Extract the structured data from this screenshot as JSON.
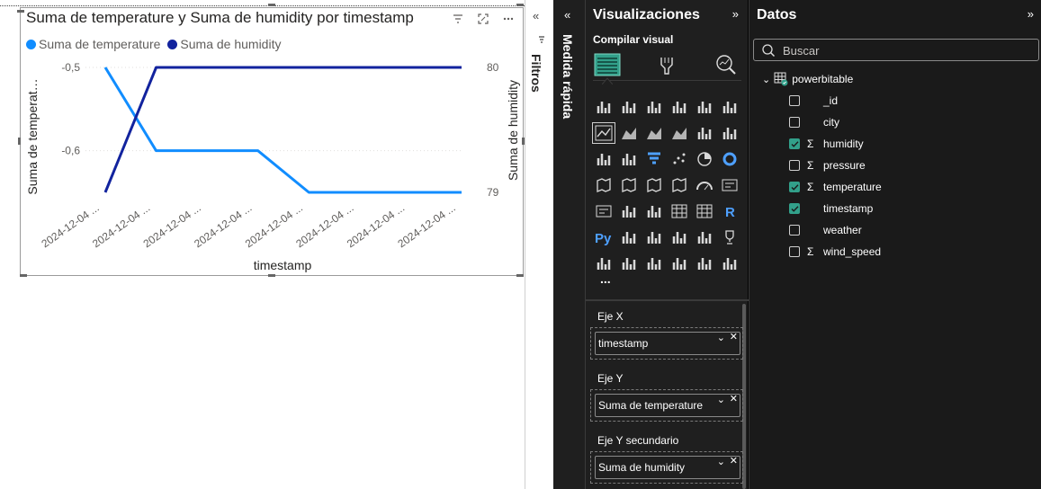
{
  "visual": {
    "title": "Suma de temperature y Suma de humidity por timestamp",
    "legend": [
      {
        "label": "Suma de temperature",
        "color": "#118dff"
      },
      {
        "label": "Suma de humidity",
        "color": "#12239e"
      }
    ],
    "header_icons": [
      "filter-icon",
      "focus-mode-icon",
      "more-options-icon"
    ]
  },
  "chart_data": {
    "type": "line",
    "title": "Suma de temperature y Suma de humidity por timestamp",
    "xlabel": "timestamp",
    "ylabel": "Suma de temperat…",
    "y2label": "Suma de humidity",
    "categories": [
      "2024-12-04 ...",
      "2024-12-04 ...",
      "2024-12-04 ...",
      "2024-12-04 ...",
      "2024-12-04 ...",
      "2024-12-04 ...",
      "2024-12-04 ...",
      "2024-12-04 ..."
    ],
    "y_ticks": [
      "-0,5",
      "-0,6"
    ],
    "y_tick_values": [
      -0.5,
      -0.6
    ],
    "y2_ticks": [
      "80",
      "79"
    ],
    "y2_tick_values": [
      80,
      79
    ],
    "ylim": [
      -0.65,
      -0.5
    ],
    "y2lim": [
      79,
      80
    ],
    "legend_position": "top-left",
    "grid": true,
    "series": [
      {
        "name": "Suma de temperature",
        "axis": "primary",
        "color": "#118dff",
        "values": [
          -0.5,
          -0.6,
          -0.6,
          -0.6,
          -0.65,
          -0.65,
          -0.65,
          -0.65
        ]
      },
      {
        "name": "Suma de humidity",
        "axis": "secondary",
        "color": "#12239e",
        "values": [
          79,
          80,
          80,
          80,
          80,
          80,
          80,
          80
        ]
      }
    ]
  },
  "filters": {
    "label": "Filtros"
  },
  "measure": {
    "label": "Medida rápida"
  },
  "viz_pane": {
    "title": "Visualizaciones",
    "build_label": "Compilar visual",
    "more": "...",
    "wells": [
      {
        "label": "Eje X",
        "field": "timestamp"
      },
      {
        "label": "Eje Y",
        "field": "Suma de temperature"
      },
      {
        "label": "Eje Y secundario",
        "field": "Suma de humidity"
      }
    ]
  },
  "data_pane": {
    "title": "Datos",
    "search_placeholder": "Buscar",
    "table": "powerbitable",
    "fields": [
      {
        "name": "_id",
        "checked": false,
        "sigma": false
      },
      {
        "name": "city",
        "checked": false,
        "sigma": false
      },
      {
        "name": "humidity",
        "checked": true,
        "sigma": true
      },
      {
        "name": "pressure",
        "checked": false,
        "sigma": true
      },
      {
        "name": "temperature",
        "checked": true,
        "sigma": true
      },
      {
        "name": "timestamp",
        "checked": true,
        "sigma": false
      },
      {
        "name": "weather",
        "checked": false,
        "sigma": false
      },
      {
        "name": "wind_speed",
        "checked": false,
        "sigma": true
      }
    ]
  }
}
